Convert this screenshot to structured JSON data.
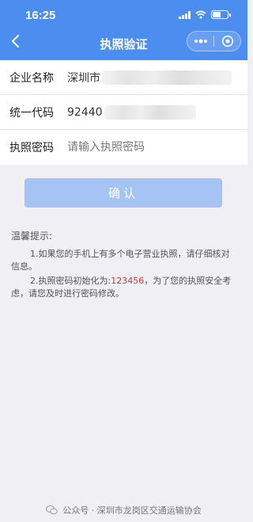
{
  "status_bar": {
    "time": "16:25"
  },
  "nav": {
    "title": "执照验证"
  },
  "form": {
    "company_label": "企业名称",
    "company_value": "深圳市",
    "code_label": "统一代码",
    "code_value": "92440",
    "password_label": "执照密码",
    "password_placeholder": "请输入执照密码"
  },
  "confirm_label": "确认",
  "tips": {
    "title": "温馨提示:",
    "item1": "1.如果您的手机上有多个电子营业执照，请仔细核对信息。",
    "item2_prefix": "2.执照密码初始化为:",
    "item2_code": "123456",
    "item2_suffix": "，为了您的执照安全考虑，请您及时进行密码修改。"
  },
  "footer": {
    "text": "公众号 · 深圳市龙岗区交通运输协会"
  },
  "colors": {
    "header": "#4c8df0",
    "button_disabled": "#a5c3f3",
    "highlight": "#e12d2d"
  }
}
